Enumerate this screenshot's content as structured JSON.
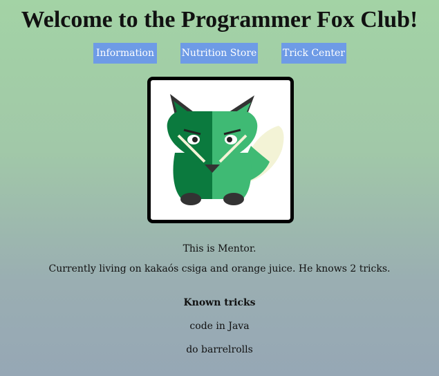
{
  "header": {
    "title": "Welcome to the Programmer Fox Club!"
  },
  "nav": {
    "items": [
      {
        "label": "Information"
      },
      {
        "label": "Nutrition Store"
      },
      {
        "label": "Trick Center"
      }
    ],
    "button_color": "#6e9be6"
  },
  "fox": {
    "image_icon": "fox-icon",
    "name_text": "This is Mentor.",
    "status_text": "Currently living on kakaós csiga and orange juice. He knows 2 tricks."
  },
  "tricks": {
    "heading": "Known tricks",
    "items": [
      {
        "label": "code in Java"
      },
      {
        "label": "do barrelrolls"
      }
    ]
  },
  "colors": {
    "fox_dark_green": "#0b7a3e",
    "fox_light_green": "#3fba74",
    "fox_ears": "#333333",
    "tail_cream": "#f3f3d6"
  }
}
